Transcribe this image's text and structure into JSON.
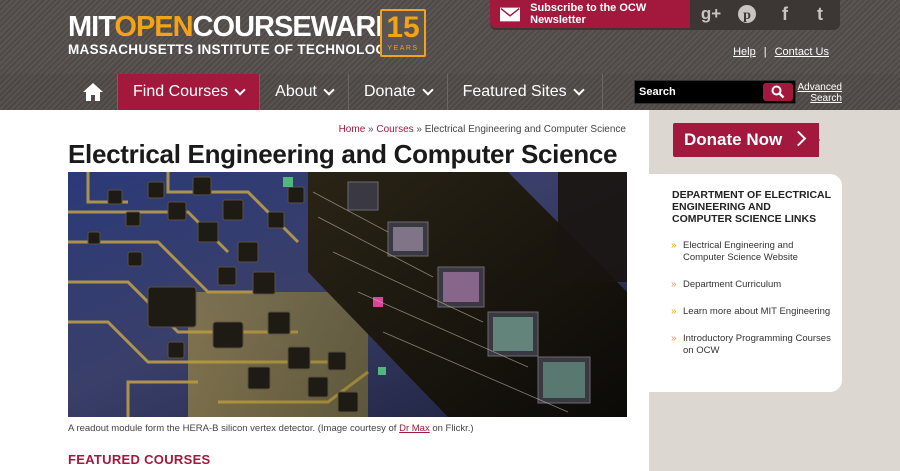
{
  "header": {
    "logo": {
      "part1": "MIT",
      "part2": "OPEN",
      "part3": "COURSEWARE",
      "subtitle": "MASSACHUSETTS INSTITUTE OF TECHNOLOGY"
    },
    "anniversary": {
      "number": "15",
      "label": "YEARS"
    },
    "newsletter_label": "Subscribe to the OCW Newsletter",
    "social_icons": [
      "google-plus-icon",
      "pinterest-icon",
      "facebook-icon",
      "twitter-icon"
    ],
    "help_label": "Help",
    "separator": "|",
    "contact_label": "Contact Us"
  },
  "nav": {
    "items": [
      {
        "label": "Find Courses",
        "active": true
      },
      {
        "label": "About",
        "active": false
      },
      {
        "label": "Donate",
        "active": false
      },
      {
        "label": "Featured Sites",
        "active": false
      }
    ],
    "search_placeholder": "Search",
    "advanced_search": "Advanced Search"
  },
  "breadcrumb": {
    "home": "Home",
    "sep1": " » ",
    "courses": "Courses",
    "sep2": " » ",
    "current": "Electrical Engineering and Computer Science"
  },
  "page_title": "Electrical Engineering and Computer Science",
  "caption": {
    "before": "A readout module form the HERA-B silicon vertex detector. (Image courtesy of ",
    "link": "Dr Max",
    "after": " on Flickr.)"
  },
  "featured_heading": "FEATURED COURSES",
  "sidebar": {
    "donate_label": "Donate Now",
    "links_title": "DEPARTMENT OF ELECTRICAL ENGINEERING AND COMPUTER SCIENCE LINKS",
    "links": [
      "Electrical Engineering and Computer Science Website",
      "Department Curriculum",
      "Learn more about MIT Engineering",
      "Introductory Programming Courses on OCW"
    ],
    "bullet": "»"
  },
  "colors": {
    "accent": "#a3193d",
    "orange": "#f3a317",
    "header_bg": "#524c4a",
    "sidebar_bg": "#ddd7d2"
  }
}
